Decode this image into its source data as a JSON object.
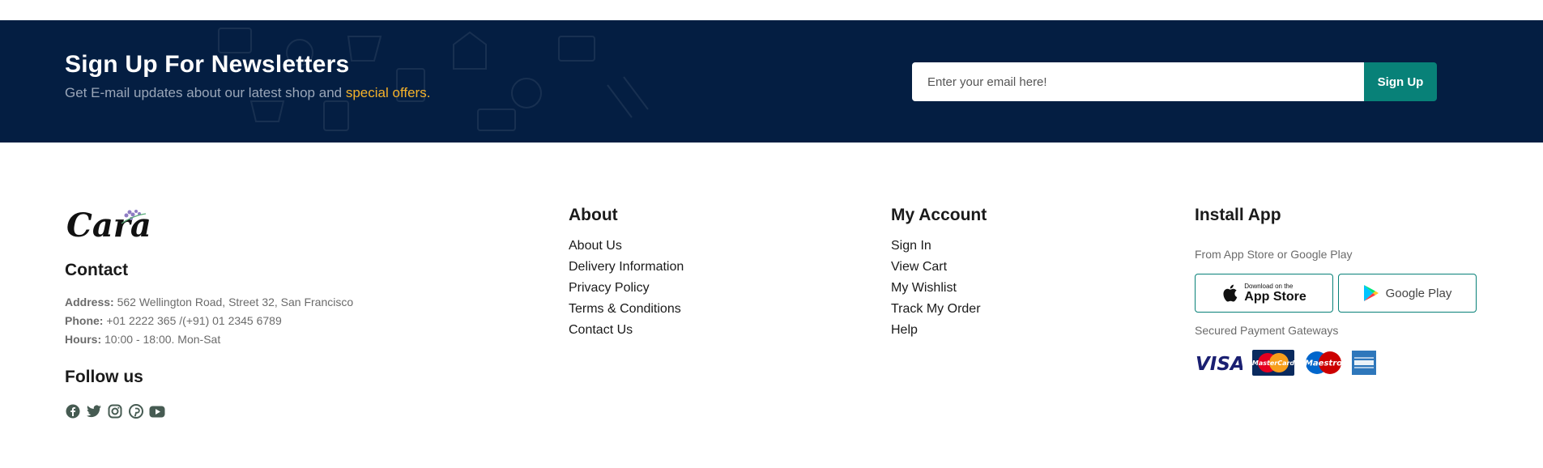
{
  "newsletter": {
    "title": "Sign Up For Newsletters",
    "subtitle": "Get E-mail updates about our latest shop and",
    "subtitle_highlight": "special offers.",
    "email_placeholder": "Enter your email here!",
    "signup_label": "Sign Up",
    "colors": {
      "background": "#041e42",
      "highlight": "#f5b22a",
      "button": "#088178"
    }
  },
  "brand": {
    "logo_text": "Cara"
  },
  "contact": {
    "heading": "Contact",
    "address_label": "Address:",
    "address": "562 Wellington Road, Street 32, San Francisco",
    "phone_label": "Phone:",
    "phone": "+01 2222 365 /(+91) 01 2345 6789",
    "hours_label": "Hours:",
    "hours": "10:00 - 18:00. Mon-Sat"
  },
  "follow": {
    "heading": "Follow us",
    "icons": [
      "facebook-icon",
      "twitter-icon",
      "instagram-icon",
      "pinterest-icon",
      "youtube-icon"
    ]
  },
  "about": {
    "heading": "About",
    "links": [
      "About Us",
      "Delivery Information",
      "Privacy Policy",
      "Terms & Conditions",
      "Contact Us"
    ]
  },
  "account": {
    "heading": "My Account",
    "links": [
      "Sign In",
      "View Cart",
      "My Wishlist",
      "Track My Order",
      "Help"
    ]
  },
  "install": {
    "heading": "Install App",
    "stores_text": "From App Store or Google Play",
    "appstore_small": "Download on the",
    "appstore_big": "App Store",
    "googleplay": "Google Play",
    "gateways_text": "Secured Payment Gateways",
    "payments": {
      "visa": "VISA",
      "mastercard": "MasterCard",
      "maestro": "Maestro"
    }
  }
}
